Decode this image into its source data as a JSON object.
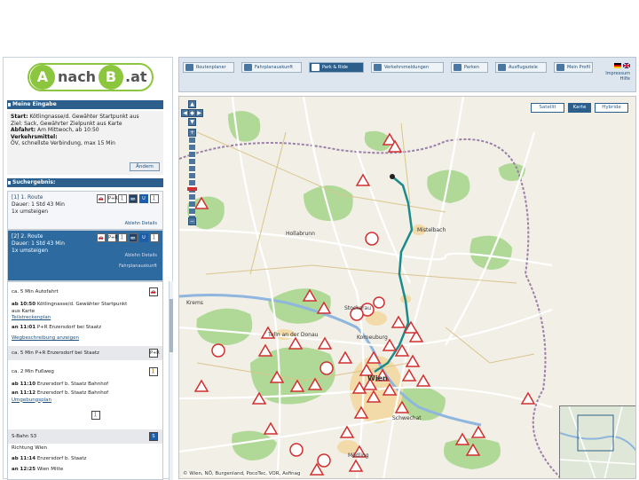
{
  "logo": {
    "left": "A",
    "middle": "nach",
    "right": "B",
    "suffix": ".at"
  },
  "eingabe": {
    "header": "Meine Eingabe",
    "start_label": "Start:",
    "start_value": "Kötlingnasse/d. Gewähter Startpunkt aus",
    "ziel_line": "Ziel: Sack, Gewährter Zielpunkt aus Karte",
    "abfahrt_label": "Abfahrt:",
    "abfahrt_value": "Am Mittwoch, ab 10:50",
    "verkehrsmittel_label": "Verkehrsmittel:",
    "verkehrsmittel_value": "ÖV, schnellste Verbindung, max 15 Min",
    "change_button": "Ändern"
  },
  "suchergebnis": {
    "header": "Suchergebnis:",
    "routes": [
      {
        "label": "[1] 1. Route",
        "duration": "Dauer: 1 Std 43 Min",
        "changes": "1x umsteigen",
        "details": "Ablehn Details",
        "selected": false
      },
      {
        "label": "[2] 2. Route",
        "duration": "Dauer: 1 Std 43 Min",
        "changes": "1x umsteigen",
        "details": "Ablehn Details",
        "extra": "Fahrplanauskunft",
        "selected": true
      }
    ],
    "mode_icons": [
      "car-icon",
      "train-icon",
      "walk-icon",
      "bus-icon",
      "ubahn-icon",
      "person-icon"
    ],
    "mode_labels": [
      "🚗",
      "P+R",
      "🚶",
      "🚌",
      "U",
      "🚶"
    ]
  },
  "detail": {
    "steps": [
      {
        "text": "ca. 5 Min Autofahrt",
        "grey": false,
        "icon": "🚗"
      },
      {
        "time": "ab 10:50",
        "text": "Kötlingnasse/d. Gewähter Startpunkt",
        "sub": "aus Karte",
        "link": "Teilstreckenplan",
        "grey": false
      },
      {
        "time": "an 11:01",
        "text": "P+R Enzersdorf bei Staatz",
        "grey": false
      },
      {
        "text": "Wegbeschreibung anzeigen",
        "grey": false,
        "is_link": true
      },
      {
        "text": "ca. 5 Min P+R Enzersdorf bei Staatz",
        "grey": true,
        "icon": "P+R"
      },
      {
        "text": "ca. 2 Min Fußweg",
        "grey": false,
        "icon": "🚶"
      },
      {
        "time": "ab 11:10",
        "text": "Enzersdorf b. Staatz Bahnhof",
        "grey": false
      },
      {
        "time": "an 11:12",
        "text": "Enzersdorf b. Staatz Bahnhof",
        "grey": false,
        "link": "Umgebungsplan"
      },
      {
        "text": "S-Bahn S3",
        "grey": true,
        "icon": "S"
      },
      {
        "text": "Richtung Wien",
        "grey": false
      },
      {
        "time": "ab 11:14",
        "text": "Enzersdorf b. Staatz",
        "grey": false
      },
      {
        "time": "an 12:25",
        "text": "Wien Mitte",
        "grey": false
      }
    ]
  },
  "toolbar": {
    "buttons": [
      {
        "label": "Routenplaner",
        "active": false
      },
      {
        "label": "Fahrplanauskunft",
        "active": false
      },
      {
        "label": "Park & Ride",
        "active": true
      },
      {
        "label": "Verkehrsmeldungen",
        "active": false
      },
      {
        "label": "Parken",
        "active": false
      },
      {
        "label": "Ausflugsziele",
        "active": false
      },
      {
        "label": "Mein Profil",
        "active": false
      }
    ],
    "links": [
      "Impressum",
      "Hilfe"
    ]
  },
  "map": {
    "types": [
      "Satellit",
      "Karte",
      "Hybride"
    ],
    "active_type": "Karte",
    "places": [
      "Mistelbach",
      "Hollabrunn",
      "Stockerau",
      "Korneuburg",
      "Tulln an der Donau",
      "Wien",
      "Schwechat",
      "Mödling",
      "Krems"
    ],
    "copyright": "© Wien, NÖ, Burgenland, PocoTec, VOR, Asfinag",
    "colors": {
      "route": "#1c8a8a",
      "forest": "#9ccf80",
      "urban": "#f0d9a6",
      "road": "#ffffff"
    }
  }
}
